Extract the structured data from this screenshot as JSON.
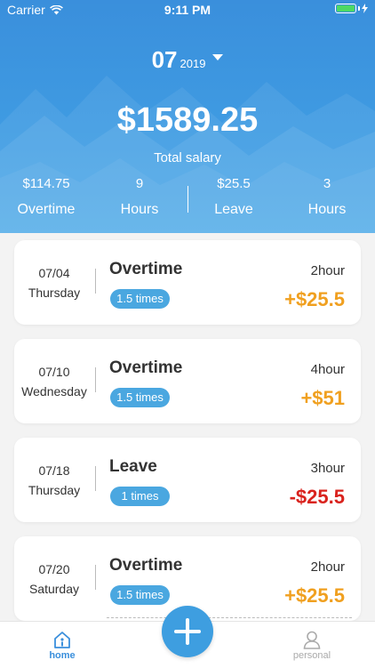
{
  "status_bar": {
    "carrier": "Carrier",
    "time": "9:11 PM"
  },
  "header": {
    "month": "07",
    "year": "2019",
    "total_amount": "$1589.25",
    "total_label": "Total salary",
    "stats": [
      {
        "value": "$114.75",
        "label": "Overtime"
      },
      {
        "value": "9",
        "label": "Hours"
      },
      {
        "value": "$25.5",
        "label": "Leave"
      },
      {
        "value": "3",
        "label": "Hours"
      }
    ]
  },
  "records": [
    {
      "date": "07/04",
      "weekday": "Thursday",
      "type": "Overtime",
      "rate": "1.5 times",
      "hours": "2hour",
      "amount": "+$25.5",
      "amount_color": "#f0a020"
    },
    {
      "date": "07/10",
      "weekday": "Wednesday",
      "type": "Overtime",
      "rate": "1.5 times",
      "hours": "4hour",
      "amount": "+$51",
      "amount_color": "#f0a020"
    },
    {
      "date": "07/18",
      "weekday": "Thursday",
      "type": "Leave",
      "rate": "1 times",
      "hours": "3hour",
      "amount": "-$25.5",
      "amount_color": "#d9231e"
    },
    {
      "date": "07/20",
      "weekday": "Saturday",
      "type": "Overtime",
      "rate": "1.5 times",
      "hours": "2hour",
      "amount": "+$25.5",
      "amount_color": "#f0a020"
    }
  ],
  "tab_bar": {
    "home_label": "home",
    "personal_label": "personal",
    "add_icon": "plus-icon",
    "active_color": "#3a8fdc",
    "inactive_color": "#aaaaaa"
  }
}
